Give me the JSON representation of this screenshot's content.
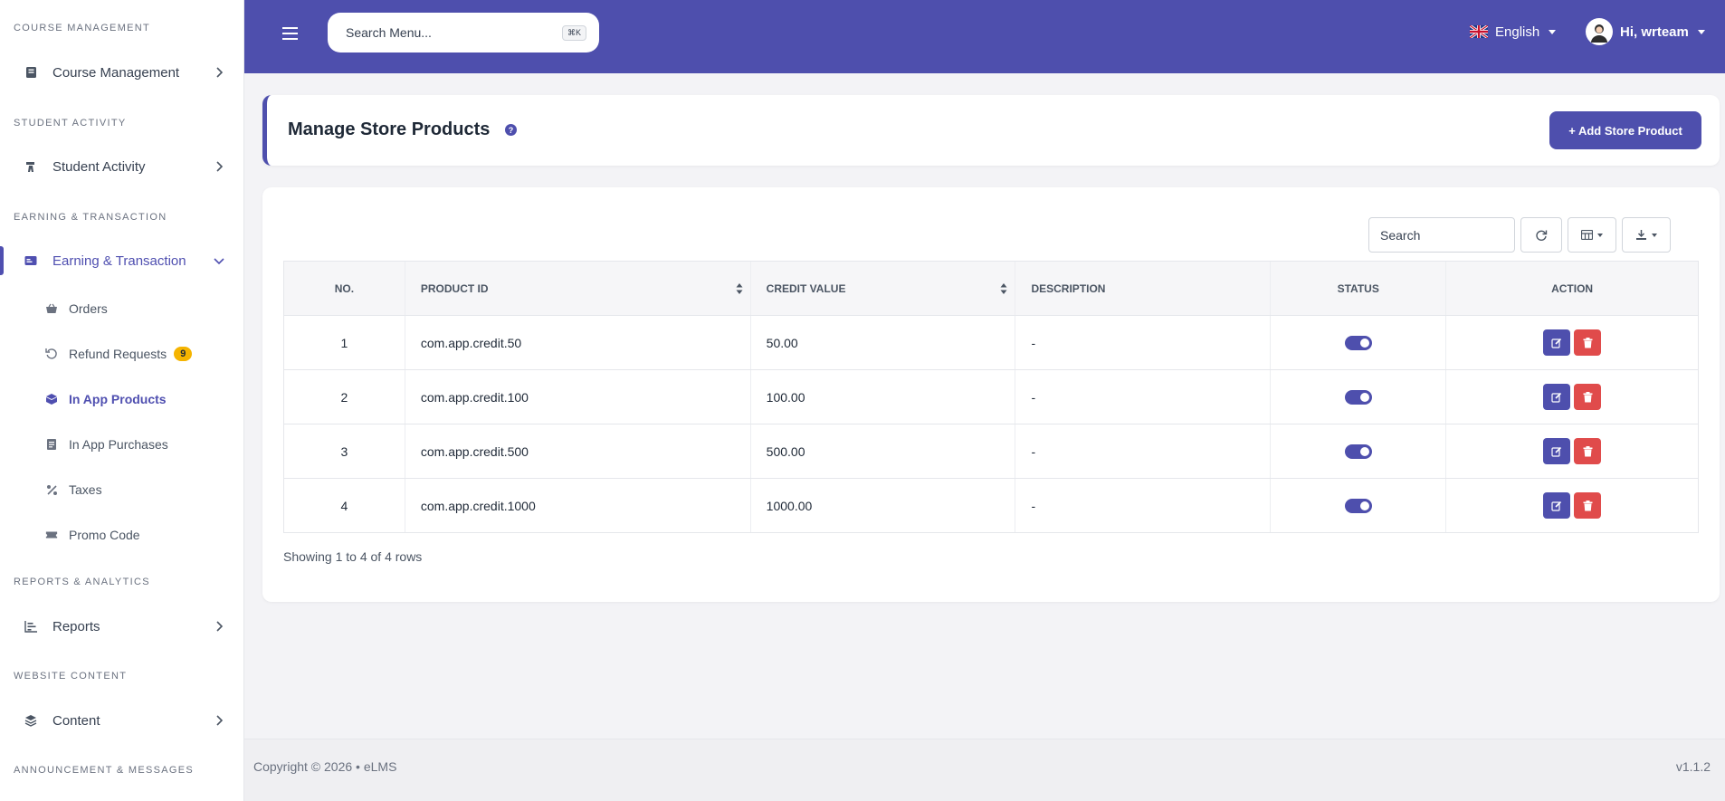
{
  "sidebar": {
    "sections": [
      {
        "title": "COURSE MANAGEMENT",
        "item": "Course Management"
      },
      {
        "title": "STUDENT ACTIVITY",
        "item": "Student Activity"
      },
      {
        "title": "EARNING & TRANSACTION",
        "item": "Earning & Transaction"
      },
      {
        "title": "REPORTS & ANALYTICS",
        "item": "Reports"
      },
      {
        "title": "WEBSITE CONTENT",
        "item": "Content"
      },
      {
        "title": "ANNOUNCEMENT & MESSAGES"
      }
    ],
    "sub_items": [
      {
        "label": "Orders",
        "icon": "basket-icon"
      },
      {
        "label": "Refund Requests",
        "icon": "refund-icon",
        "badge": "9"
      },
      {
        "label": "In App Products",
        "icon": "box-icon"
      },
      {
        "label": "In App Purchases",
        "icon": "receipt-icon"
      },
      {
        "label": "Taxes",
        "icon": "percent-icon"
      },
      {
        "label": "Promo Code",
        "icon": "ticket-icon"
      }
    ]
  },
  "topbar": {
    "search_placeholder": "Search Menu...",
    "shortcut": "⌘K",
    "language": "English",
    "greeting": "Hi, wrteam"
  },
  "page": {
    "title": "Manage Store Products",
    "add_button": "+ Add Store Product"
  },
  "table": {
    "search_placeholder": "Search",
    "columns": [
      "NO.",
      "PRODUCT ID",
      "CREDIT VALUE",
      "DESCRIPTION",
      "STATUS",
      "ACTION"
    ],
    "rows": [
      {
        "no": "1",
        "product_id": "com.app.credit.50",
        "credit_value": "50.00",
        "description": "-",
        "status": true
      },
      {
        "no": "2",
        "product_id": "com.app.credit.100",
        "credit_value": "100.00",
        "description": "-",
        "status": true
      },
      {
        "no": "3",
        "product_id": "com.app.credit.500",
        "credit_value": "500.00",
        "description": "-",
        "status": true
      },
      {
        "no": "4",
        "product_id": "com.app.credit.1000",
        "credit_value": "1000.00",
        "description": "-",
        "status": true
      }
    ],
    "showing": "Showing 1 to 4 of 4 rows"
  },
  "footer": {
    "copyright": "Copyright © 2026  •  eLMS",
    "version": "v1.1.2"
  },
  "colors": {
    "primary": "#4e4fad",
    "danger": "#e04b4b",
    "badge": "#f5b400"
  }
}
